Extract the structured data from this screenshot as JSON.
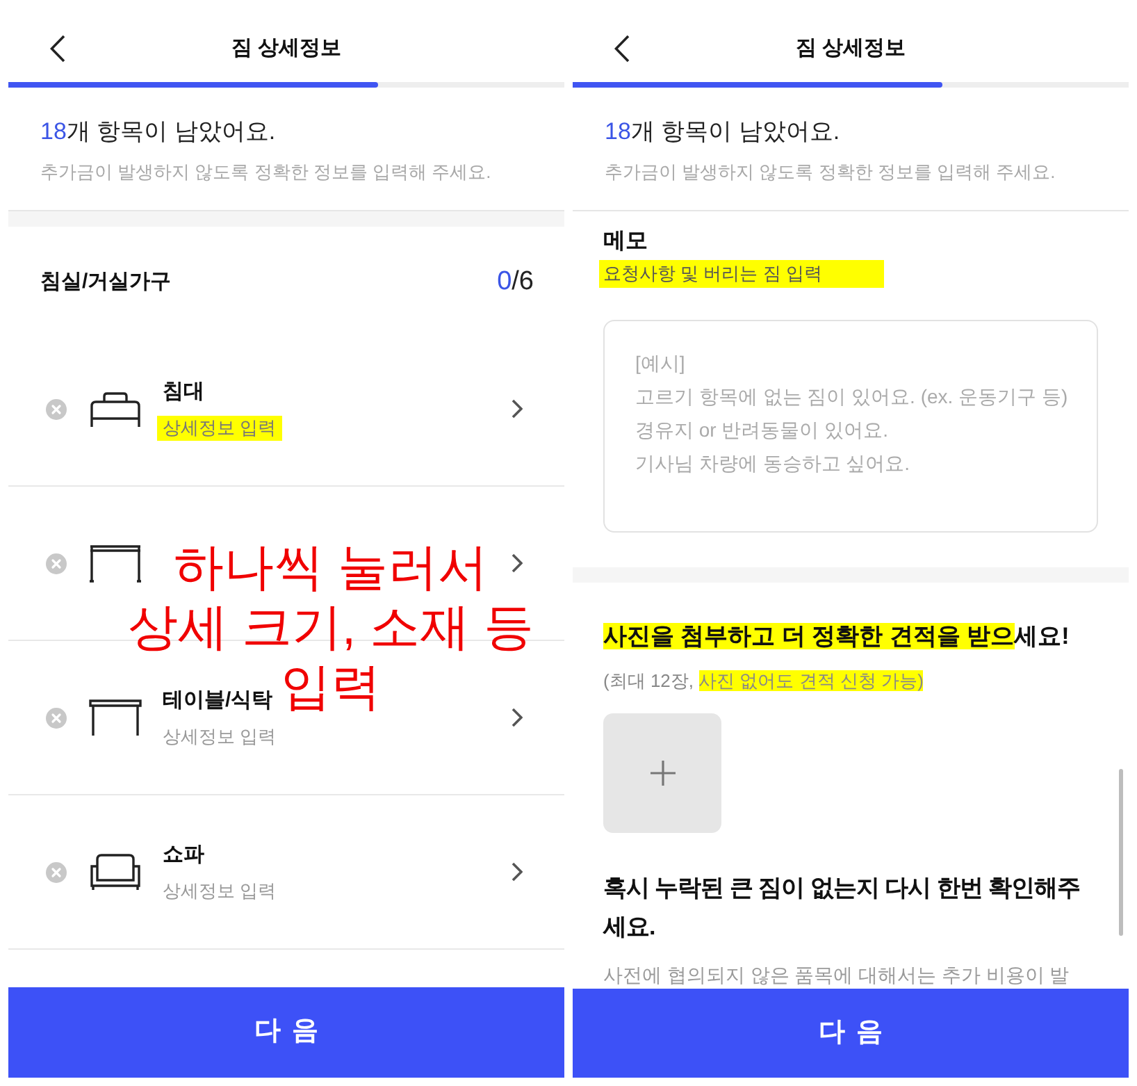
{
  "screens": [
    {
      "kind": "furniture_list",
      "title": "짐 상세정보",
      "progress": {
        "level": 0.665
      },
      "remaining": {
        "count": "18",
        "text": "개 항목이 남았어요."
      },
      "notice": "추가금이 발생하지 않도록 정확한 정보를 입력해 주세요.",
      "category": {
        "name": "침실/거실가구",
        "done": "0",
        "rest": "/6"
      },
      "items": [
        {
          "kind": "bed",
          "title": "침대",
          "subtitle": "상세정보 입력",
          "highlighted": true
        },
        {
          "kind": "frame"
        },
        {
          "kind": "table",
          "title": "테이블/식탁",
          "subtitle": "상세정보 입력",
          "highlighted": false
        },
        {
          "kind": "sofa",
          "title": "쇼파",
          "subtitle": "상세정보 입력",
          "highlighted": false
        }
      ],
      "button": "다음"
    },
    {
      "kind": "memo_form",
      "title": "짐 상세정보",
      "progress": {
        "level": 0.665
      },
      "remaining": {
        "count": "18",
        "text": "개 항목이 남았어요."
      },
      "notice": "추가금이 발생하지 않도록 정확한 정보를 입력해 주세요.",
      "memo": {
        "label": "메모",
        "hint": "요청사항 및 버리는 짐 입력",
        "hint_highlighted": true,
        "placeholder": "[예시]\n고르기 항목에 없는 짐이 있어요. (ex. 운동기구 등)\n경유지 or 반려동물이 있어요.\n기사님 차량에 동승하고 싶어요."
      },
      "photos": {
        "heading": [
          {
            "text": "사진을 첨부하고 더 정확한 견적을 받으",
            "highlighted": true
          },
          {
            "text": "세요!",
            "highlighted": false
          }
        ],
        "note": [
          {
            "text": "(최대 12장, ",
            "highlighted": false
          },
          {
            "text": "사진 없어도 견적 신청 가능)",
            "highlighted": true
          }
        ]
      },
      "reminder": {
        "heading": "혹시 누락된 큰 짐이 없는지 다시 한번 확인해주세요.",
        "body": "사전에 협의되지 않은 품목에 대해서는 추가 비용이 발"
      },
      "button": "다음"
    }
  ],
  "annotation": {
    "lines": [
      "하나씩 눌러서",
      "상세 크기, 소재 등",
      "입력"
    ]
  }
}
